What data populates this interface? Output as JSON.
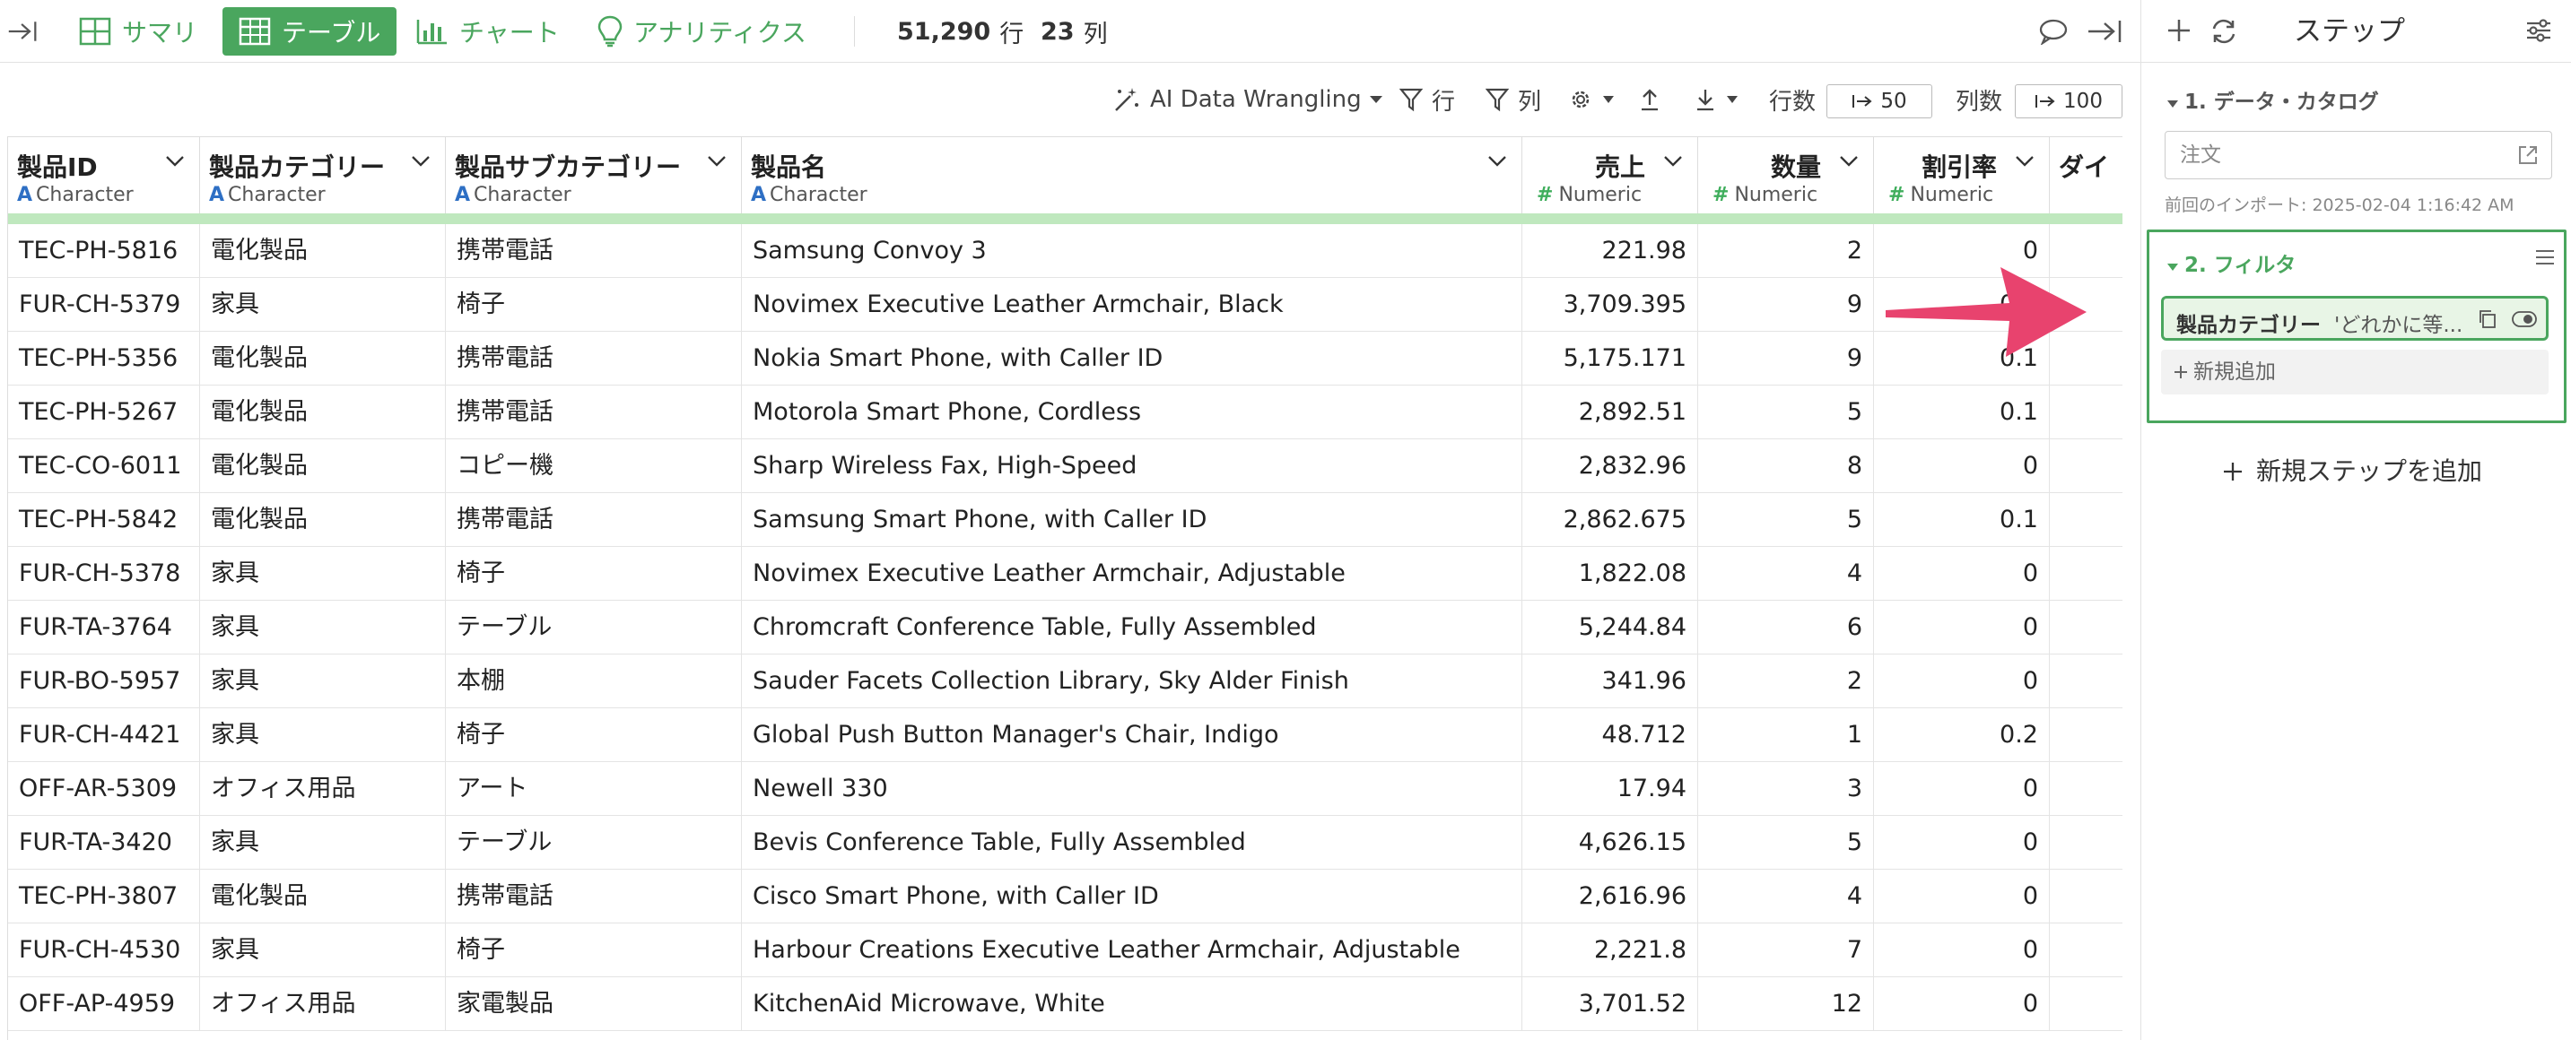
{
  "topbar": {
    "summary": "サマリ",
    "table": "テーブル",
    "chart": "チャート",
    "analytics": "アナリティクス",
    "rows_value": "51,290",
    "rows_unit": "行",
    "cols_value": "23",
    "cols_unit": "列"
  },
  "toolbar": {
    "ai": "AI Data Wrangling",
    "row_filter": "行",
    "col_filter": "列",
    "rows_label": "行数",
    "rows_limit": "50",
    "cols_label": "列数",
    "cols_limit": "100"
  },
  "columns": [
    {
      "name": "製品ID",
      "type": "Character",
      "kind": "char"
    },
    {
      "name": "製品カテゴリー",
      "type": "Character",
      "kind": "char"
    },
    {
      "name": "製品サブカテゴリー",
      "type": "Character",
      "kind": "char"
    },
    {
      "name": "製品名",
      "type": "Character",
      "kind": "char"
    },
    {
      "name": "売上",
      "type": "Numeric",
      "kind": "num"
    },
    {
      "name": "数量",
      "type": "Numeric",
      "kind": "num"
    },
    {
      "name": "割引率",
      "type": "Numeric",
      "kind": "num"
    },
    {
      "name": "ダイ",
      "type": "",
      "kind": "cut"
    }
  ],
  "rows": [
    [
      "TEC-PH-5816",
      "電化製品",
      "携帯電話",
      "Samsung Convoy 3",
      "221.98",
      "2",
      "0"
    ],
    [
      "FUR-CH-5379",
      "家具",
      "椅子",
      "Novimex Executive Leather Armchair, Black",
      "3,709.395",
      "9",
      "0.1"
    ],
    [
      "TEC-PH-5356",
      "電化製品",
      "携帯電話",
      "Nokia Smart Phone, with Caller ID",
      "5,175.171",
      "9",
      "0.1"
    ],
    [
      "TEC-PH-5267",
      "電化製品",
      "携帯電話",
      "Motorola Smart Phone, Cordless",
      "2,892.51",
      "5",
      "0.1"
    ],
    [
      "TEC-CO-6011",
      "電化製品",
      "コピー機",
      "Sharp Wireless Fax, High-Speed",
      "2,832.96",
      "8",
      "0"
    ],
    [
      "TEC-PH-5842",
      "電化製品",
      "携帯電話",
      "Samsung Smart Phone, with Caller ID",
      "2,862.675",
      "5",
      "0.1"
    ],
    [
      "FUR-CH-5378",
      "家具",
      "椅子",
      "Novimex Executive Leather Armchair, Adjustable",
      "1,822.08",
      "4",
      "0"
    ],
    [
      "FUR-TA-3764",
      "家具",
      "テーブル",
      "Chromcraft Conference Table, Fully Assembled",
      "5,244.84",
      "6",
      "0"
    ],
    [
      "FUR-BO-5957",
      "家具",
      "本棚",
      "Sauder Facets Collection Library, Sky Alder Finish",
      "341.96",
      "2",
      "0"
    ],
    [
      "FUR-CH-4421",
      "家具",
      "椅子",
      "Global Push Button Manager's Chair, Indigo",
      "48.712",
      "1",
      "0.2"
    ],
    [
      "OFF-AR-5309",
      "オフィス用品",
      "アート",
      "Newell 330",
      "17.94",
      "3",
      "0"
    ],
    [
      "FUR-TA-3420",
      "家具",
      "テーブル",
      "Bevis Conference Table, Fully Assembled",
      "4,626.15",
      "5",
      "0"
    ],
    [
      "TEC-PH-3807",
      "電化製品",
      "携帯電話",
      "Cisco Smart Phone, with Caller ID",
      "2,616.96",
      "4",
      "0"
    ],
    [
      "FUR-CH-4530",
      "家具",
      "椅子",
      "Harbour Creations Executive Leather Armchair, Adjustable",
      "2,221.8",
      "7",
      "0"
    ],
    [
      "OFF-AP-4959",
      "オフィス用品",
      "家電製品",
      "KitchenAid Microwave, White",
      "3,701.52",
      "12",
      "0"
    ]
  ],
  "panel": {
    "title": "ステップ",
    "step1": "1. データ・カタログ",
    "source": "注文",
    "import_note": "前回のインポート: 2025-02-04 1:16:42 AM",
    "step2": "2. フィルタ",
    "chip_key": "製品カテゴリー",
    "chip_value": "'どれかに等...",
    "add_new": "新規追加",
    "add_step": "新規ステップを追加"
  },
  "colors": {
    "accent": "#4aa65e",
    "arrow": "#e8436e",
    "char_type": "#2e6fc4"
  }
}
